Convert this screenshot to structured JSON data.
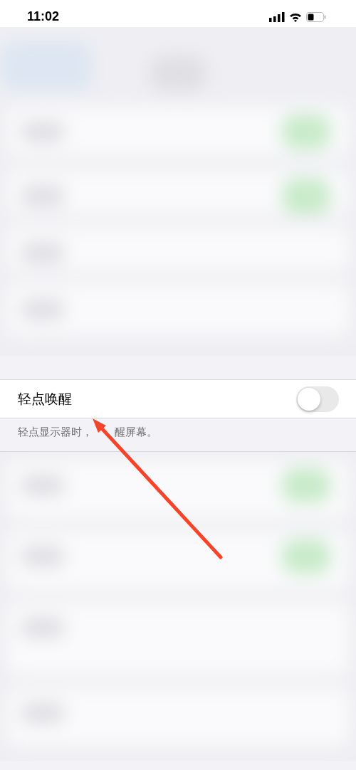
{
  "status_bar": {
    "time": "11:02"
  },
  "setting": {
    "label": "轻点唤醒",
    "on": false,
    "footer": [
      "轻点显示器时，",
      "醒屏幕。"
    ]
  }
}
